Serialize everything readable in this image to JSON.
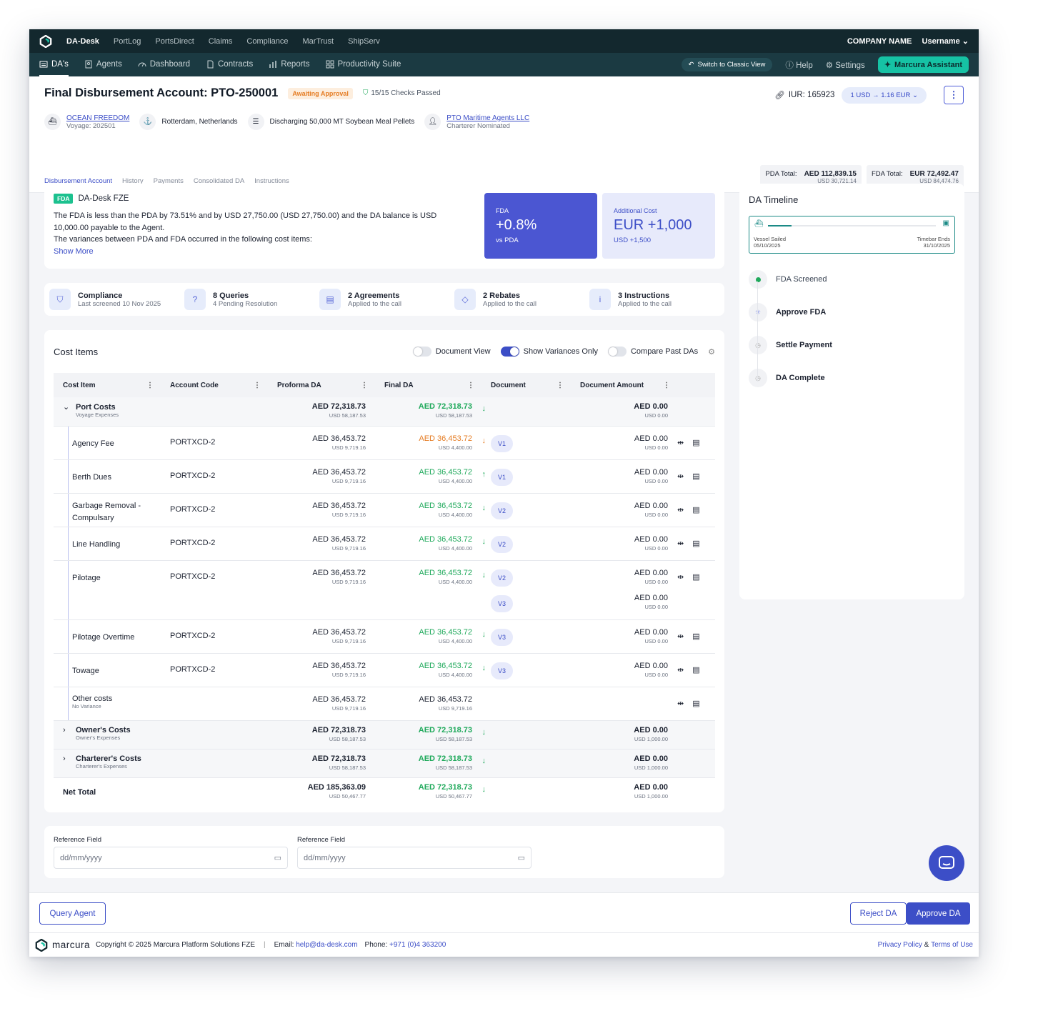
{
  "topbar": {
    "brand": "DA-Desk",
    "links": [
      "PortLog",
      "PortsDirect",
      "Claims",
      "Compliance",
      "MarTrust",
      "ShipServ"
    ],
    "company": "COMPANY NAME",
    "username": "Username"
  },
  "subnav": {
    "tabs": [
      "DA's",
      "Agents",
      "Dashboard",
      "Contracts",
      "Reports",
      "Productivity Suite"
    ],
    "classic": "Switch to Classic View",
    "help": "Help",
    "settings": "Settings",
    "assistant": "Marcura Assistant"
  },
  "header": {
    "title": "Final Disbursement Account: PTO-250001",
    "status": "Awaiting Approval",
    "checks": "15/15 Checks Passed",
    "iur": "IUR: 165923",
    "fx_from": "1 USD",
    "fx_to": "1.16 EUR",
    "vessel": "OCEAN FREEDOM",
    "voyage": "Voyage: 202501",
    "port": "Rotterdam, Netherlands",
    "operation": "Discharging 50,000 MT Soybean Meal Pellets",
    "agent": "PTO Maritime Agents LLC",
    "agent_sub": "Charterer Nominated",
    "pda_label": "PDA Total:",
    "pda_value": "AED 112,839.15",
    "pda_usd": "USD 30,721.14",
    "fda_label": "FDA Total:",
    "fda_value": "EUR 72,492.47",
    "fda_usd": "USD 84,474.76",
    "tabs": [
      "Disbursement Account",
      "History",
      "Payments",
      "Consolidated DA",
      "Instructions"
    ]
  },
  "summary": {
    "tag": "FDA",
    "company": "DA-Desk FZE",
    "line1": "The FDA is less than the PDA by 73.51% and by USD 27,750.00 (USD 27,750.00) and the DA balance is USD",
    "line2": "10,000.00 payable to the Agent.",
    "line3": "The variances between PDA and FDA occurred in the following cost items:",
    "show_more": "Show More",
    "kpi1_label": "FDA",
    "kpi1_value": "+0.8%",
    "kpi1_sub": "vs PDA",
    "kpi2_label": "Additional Cost",
    "kpi2_value": "EUR +1,000",
    "kpi2_sub": "USD +1,500"
  },
  "strip": [
    {
      "title": "Compliance",
      "sub": "Last screened 10 Nov 2025",
      "icon": "shield-check-icon"
    },
    {
      "title": "8 Queries",
      "sub": "4 Pending Resolution",
      "icon": "question-icon"
    },
    {
      "title": "2 Agreements",
      "sub": "Applied to the call",
      "icon": "document-icon"
    },
    {
      "title": "2 Rebates",
      "sub": "Applied to the call",
      "icon": "tag-icon"
    },
    {
      "title": "3 Instructions",
      "sub": "Applied to the call",
      "icon": "info-icon"
    }
  ],
  "costs": {
    "title": "Cost Items",
    "toggle1": "Document View",
    "toggle2": "Show Variances Only",
    "toggle3": "Compare Past DAs",
    "columns": [
      "Cost Item",
      "Account Code",
      "Proforma DA",
      "Final DA",
      "Document",
      "Document Amount"
    ],
    "group1": {
      "name": "Port Costs",
      "sub": "Voyage Expenses",
      "pda": "AED 72,318.73",
      "pda_usd": "USD 58,187.53",
      "fda": "AED 72,318.73",
      "fda_usd": "USD 58,187.53",
      "doc": "AED 0.00",
      "doc_usd": "USD 0.00"
    },
    "rows": [
      {
        "name": "Agency Fee",
        "code": "PORTXCD-2",
        "pda": "AED 36,453.72",
        "pda_usd": "USD 9,719.16",
        "fda": "AED 36,453.72",
        "fda_usd": "USD 4,400.00",
        "docs": [
          "V1"
        ],
        "doc": "AED 0.00",
        "doc_usd": "USD 0.00"
      },
      {
        "name": "Berth Dues",
        "code": "PORTXCD-2",
        "pda": "AED 36,453.72",
        "pda_usd": "USD 9,719.16",
        "fda": "AED 36,453.72",
        "fda_usd": "USD 4,400.00",
        "docs": [
          "V1"
        ],
        "doc": "AED 0.00",
        "doc_usd": "USD 0.00"
      },
      {
        "name": "Garbage Removal - Compulsary",
        "code": "PORTXCD-2",
        "pda": "AED 36,453.72",
        "pda_usd": "USD 9,719.16",
        "fda": "AED 36,453.72",
        "fda_usd": "USD 4,400.00",
        "docs": [
          "V2"
        ],
        "doc": "AED 0.00",
        "doc_usd": "USD 0.00"
      },
      {
        "name": "Line Handling",
        "code": "PORTXCD-2",
        "pda": "AED 36,453.72",
        "pda_usd": "USD 9,719.16",
        "fda": "AED 36,453.72",
        "fda_usd": "USD 4,400.00",
        "docs": [
          "V2"
        ],
        "doc": "AED 0.00",
        "doc_usd": "USD 0.00"
      },
      {
        "name": "Pilotage",
        "code": "PORTXCD-2",
        "pda": "AED 36,453.72",
        "pda_usd": "USD 9,719.16",
        "fda": "AED 36,453.72",
        "fda_usd": "USD 4,400.00",
        "docs": [
          "V2",
          "V3"
        ],
        "doc": "AED 0.00",
        "doc_usd": "USD 0.00"
      },
      {
        "name": "Pilotage Overtime",
        "code": "PORTXCD-2",
        "pda": "AED 36,453.72",
        "pda_usd": "USD 9,719.16",
        "fda": "AED 36,453.72",
        "fda_usd": "USD 4,400.00",
        "docs": [
          "V3"
        ],
        "doc": "AED 0.00",
        "doc_usd": "USD 0.00"
      },
      {
        "name": "Towage",
        "code": "PORTXCD-2",
        "pda": "AED 36,453.72",
        "pda_usd": "USD 9,719.16",
        "fda": "AED 36,453.72",
        "fda_usd": "USD 4,400.00",
        "docs": [
          "V3"
        ],
        "doc": "AED 0.00",
        "doc_usd": "USD 0.00"
      }
    ],
    "other": {
      "name": "Other costs",
      "sub": "No Variance",
      "pda": "AED 36,453.72",
      "pda_usd": "USD 9,719.16",
      "fda": "AED 36,453.72",
      "fda_usd": "USD 9,719.16"
    },
    "owners": {
      "name": "Owner's Costs",
      "sub": "Owner's Expenses",
      "pda": "AED 72,318.73",
      "pda_usd": "USD 58,187.53",
      "fda": "AED 72,318.73",
      "fda_usd": "USD 58,187.53",
      "doc": "AED 0.00",
      "doc_usd": "USD 1,000.00"
    },
    "charterers": {
      "name": "Charterer's Costs",
      "sub": "Charterer's Expenses",
      "pda": "AED 72,318.73",
      "pda_usd": "USD 58,187.53",
      "fda": "AED 72,318.73",
      "fda_usd": "USD 58,187.53",
      "doc": "AED 0.00",
      "doc_usd": "USD 1,000.00"
    },
    "net": {
      "name": "Net Total",
      "pda": "AED 185,363.09",
      "pda_usd": "USD 50,467.77",
      "fda": "AED 72,318.73",
      "fda_usd": "USD 50,467.77",
      "doc": "AED 0.00",
      "doc_usd": "USD 1,000.00"
    }
  },
  "refs": {
    "label1": "Reference Field",
    "label2": "Reference Field",
    "placeholder": "dd/mm/yyyy"
  },
  "timeline": {
    "title": "DA Timeline",
    "start_label": "Vessel Sailed",
    "start_date": "05/10/2025",
    "end_label": "Timebar Ends",
    "end_date": "31/10/2025",
    "steps": [
      "FDA Screened",
      "Approve FDA",
      "Settle Payment",
      "DA Complete"
    ]
  },
  "actions": {
    "query": "Query Agent",
    "reject": "Reject DA",
    "approve": "Approve DA"
  },
  "footer": {
    "brand": "marcura",
    "copyright": "Copyright © 2025 Marcura Platform Solutions FZE",
    "email_label": "Email:",
    "email": "help@da-desk.com",
    "phone_label": "Phone:",
    "phone": "+971 (0)4 363200",
    "privacy": "Privacy Policy",
    "amp": "&",
    "terms": "Terms of Use"
  },
  "colors": {
    "primary": "#3c4ec7",
    "green": "#1fa95b",
    "orange": "#e57d25",
    "teal": "#16c2a4",
    "navy": "#13282e"
  }
}
